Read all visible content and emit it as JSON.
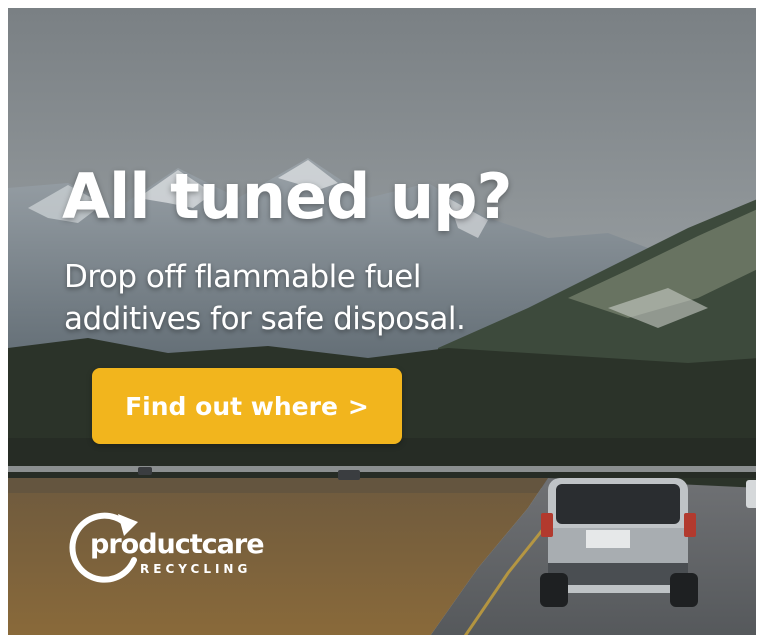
{
  "ad": {
    "headline": "All tuned up?",
    "subline_1": "Drop off flammable fuel",
    "subline_2": "additives for safe disposal.",
    "cta_label": "Find out where",
    "cta_chevron": ">",
    "logo_word": "productcare",
    "logo_sub": "RECYCLING"
  },
  "colors": {
    "cta": "#f2b51d",
    "text": "#ffffff",
    "sky": "#8f9599",
    "forest": "#2b3329"
  },
  "icons": {
    "logo": "recycle-arrow-icon",
    "cta": "chevron-right-icon"
  }
}
